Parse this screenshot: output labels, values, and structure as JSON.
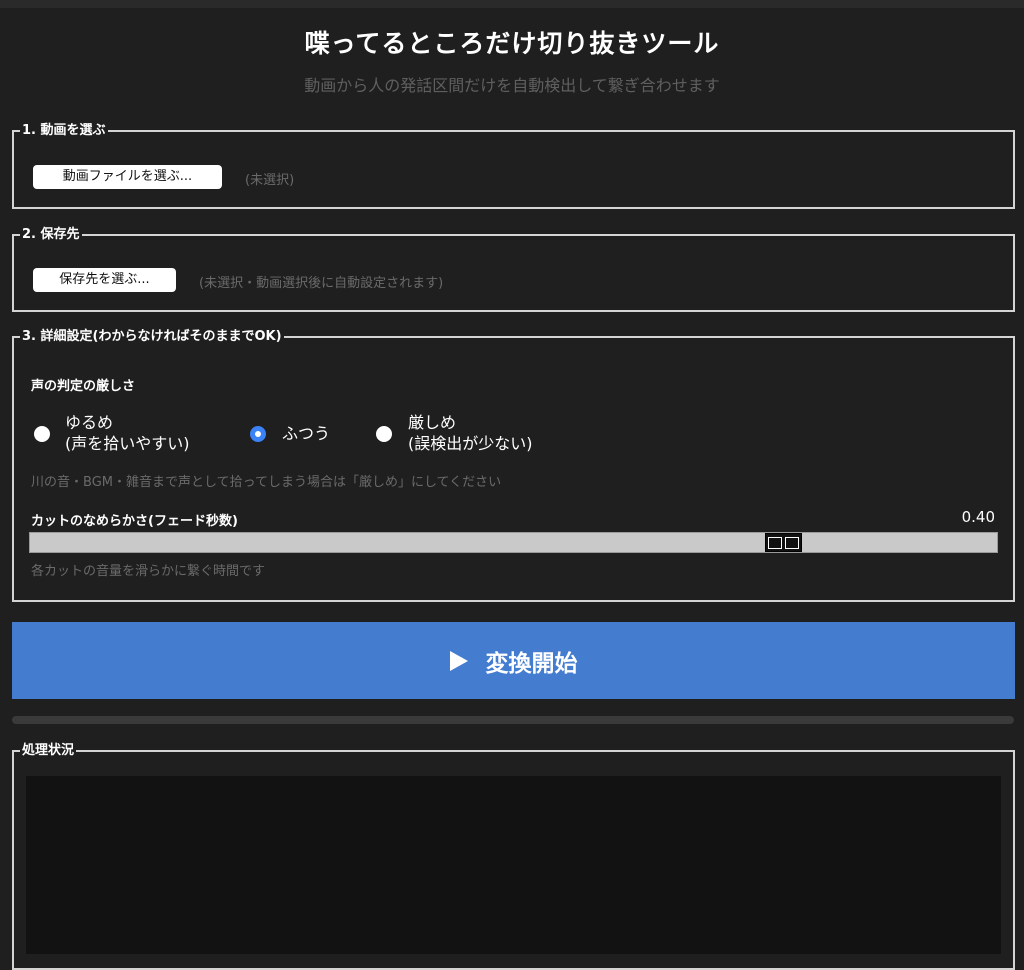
{
  "header": {
    "title": "喋ってるところだけ切り抜きツール",
    "subtitle": "動画から人の発話区間だけを自動検出して繋ぎ合わせます"
  },
  "step1": {
    "legend": "1. 動画を選ぶ",
    "button_label": "動画ファイルを選ぶ...",
    "status": "(未選択)"
  },
  "step2": {
    "legend": "2. 保存先",
    "button_label": "保存先を選ぶ...",
    "status": "(未選択・動画選択後に自動設定されます)"
  },
  "step3": {
    "legend": "3. 詳細設定(わからなければそのままでOK)",
    "sensitivity": {
      "label": "声の判定の厳しさ",
      "options": [
        {
          "line1": "ゆるめ",
          "line2": "(声を拾いやすい)",
          "selected": false
        },
        {
          "line1": "ふつう",
          "line2": "",
          "selected": true
        },
        {
          "line1": "厳しめ",
          "line2": "(誤検出が少ない)",
          "selected": false
        }
      ],
      "hint": "川の音・BGM・雑音まで声として拾ってしまう場合は「厳しめ」にしてください"
    },
    "fade": {
      "label": "カットのなめらかさ(フェード秒数)",
      "value_text": "0.40",
      "value_fraction": 0.79,
      "hint": "各カットの音量を滑らかに繋ぐ時間です"
    }
  },
  "start_button": {
    "icon": "play-icon",
    "label": "変換開始"
  },
  "progress": {
    "value_fraction": 0
  },
  "status_panel": {
    "legend": "処理状況",
    "log": ""
  },
  "colors": {
    "background": "#1f1f1f",
    "accent": "#447ccf",
    "radio_selected": "#3b82f6",
    "muted_text": "#6a6a6a"
  }
}
